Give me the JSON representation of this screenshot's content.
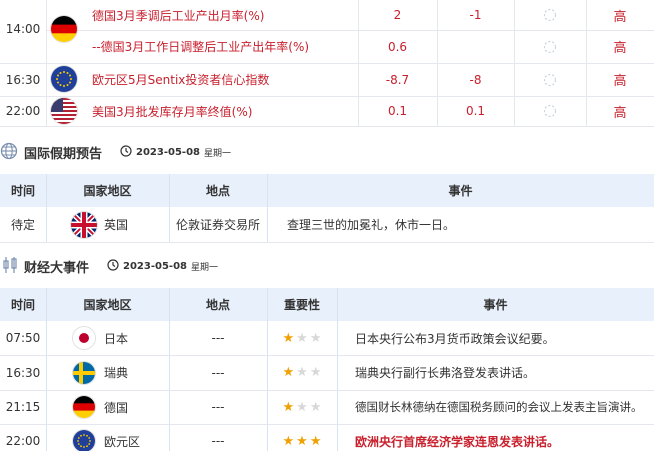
{
  "economic_rows": [
    {
      "time": "14:00",
      "flag": "germany",
      "title": "德国3月季调后工业产出月率(%)",
      "actual": "2",
      "forecast": "-1",
      "importance": "高"
    },
    {
      "time": "",
      "flag": "",
      "title": "--德国3月工作日调整后工业产出年率(%)",
      "actual": "0.6",
      "forecast": "",
      "importance": "高"
    },
    {
      "time": "16:30",
      "flag": "eu",
      "title": "欧元区5月Sentix投资者信心指数",
      "actual": "-8.7",
      "forecast": "-8",
      "importance": "高"
    },
    {
      "time": "22:00",
      "flag": "usa",
      "title": "美国3月批发库存月率终值(%)",
      "actual": "0.1",
      "forecast": "0.1",
      "importance": "高"
    }
  ],
  "holiday": {
    "title": "国际假期预告",
    "date": "2023-05-08",
    "weekday": "星期一",
    "headers": {
      "time": "时间",
      "region": "国家地区",
      "place": "地点",
      "event": "事件"
    },
    "rows": [
      {
        "time": "待定",
        "flag": "uk",
        "region": "英国",
        "place": "伦敦证券交易所",
        "event": "查理三世的加冕礼，休市一日。"
      }
    ]
  },
  "events": {
    "title": "财经大事件",
    "date": "2023-05-08",
    "weekday": "星期一",
    "headers": {
      "time": "时间",
      "region": "国家地区",
      "place": "地点",
      "importance": "重要性",
      "event": "事件"
    },
    "rows": [
      {
        "time": "07:50",
        "flag": "japan",
        "region": "日本",
        "place": "---",
        "stars": 1,
        "event": "日本央行公布3月货币政策会议纪要。",
        "highlight": false
      },
      {
        "time": "16:30",
        "flag": "sweden",
        "region": "瑞典",
        "place": "---",
        "stars": 1,
        "event": "瑞典央行副行长弗洛登发表讲话。",
        "highlight": false
      },
      {
        "time": "21:15",
        "flag": "germany",
        "region": "德国",
        "place": "---",
        "stars": 1,
        "event": "德国财长林德纳在德国税务顾问的会议上发表主旨演讲。",
        "highlight": false
      },
      {
        "time": "22:00",
        "flag": "eu",
        "region": "欧元区",
        "place": "---",
        "stars": 3,
        "event": "欧洲央行首席经济学家连恩发表讲话。",
        "highlight": true
      }
    ]
  },
  "colors": {
    "accent_red": "#c8202d",
    "header_bg": "#e8f0fb",
    "star": "#f0a000"
  }
}
